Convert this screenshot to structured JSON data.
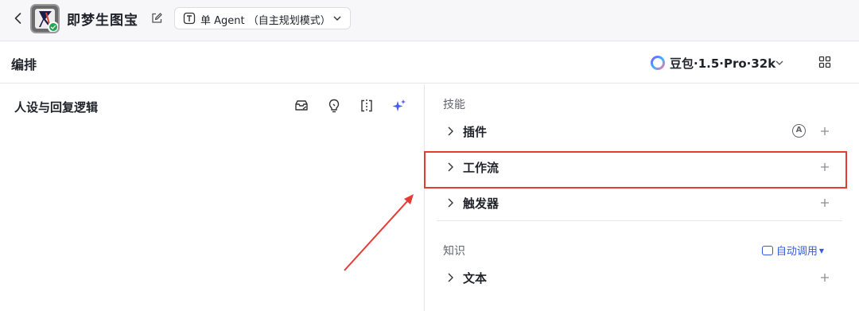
{
  "header": {
    "app_title": "即梦生图宝",
    "mode_label": "单 Agent （自主规划模式）"
  },
  "toolbar": {
    "section_title": "编排",
    "model_label": "豆包·1.5·Pro·32k"
  },
  "left_panel": {
    "persona_title": "人设与回复逻辑"
  },
  "right_panel": {
    "skills_label": "技能",
    "skills": [
      {
        "label": "插件"
      },
      {
        "label": "工作流"
      },
      {
        "label": "触发器"
      }
    ],
    "knowledge_label": "知识",
    "auto_call_label": "自动调用",
    "knowledge": [
      {
        "label": "文本"
      }
    ],
    "plugin_auto_badge": "A"
  },
  "colors": {
    "highlight": "#e53b34",
    "accent_blue": "#3a5bd9",
    "sparkle": "#4c5bf0"
  }
}
